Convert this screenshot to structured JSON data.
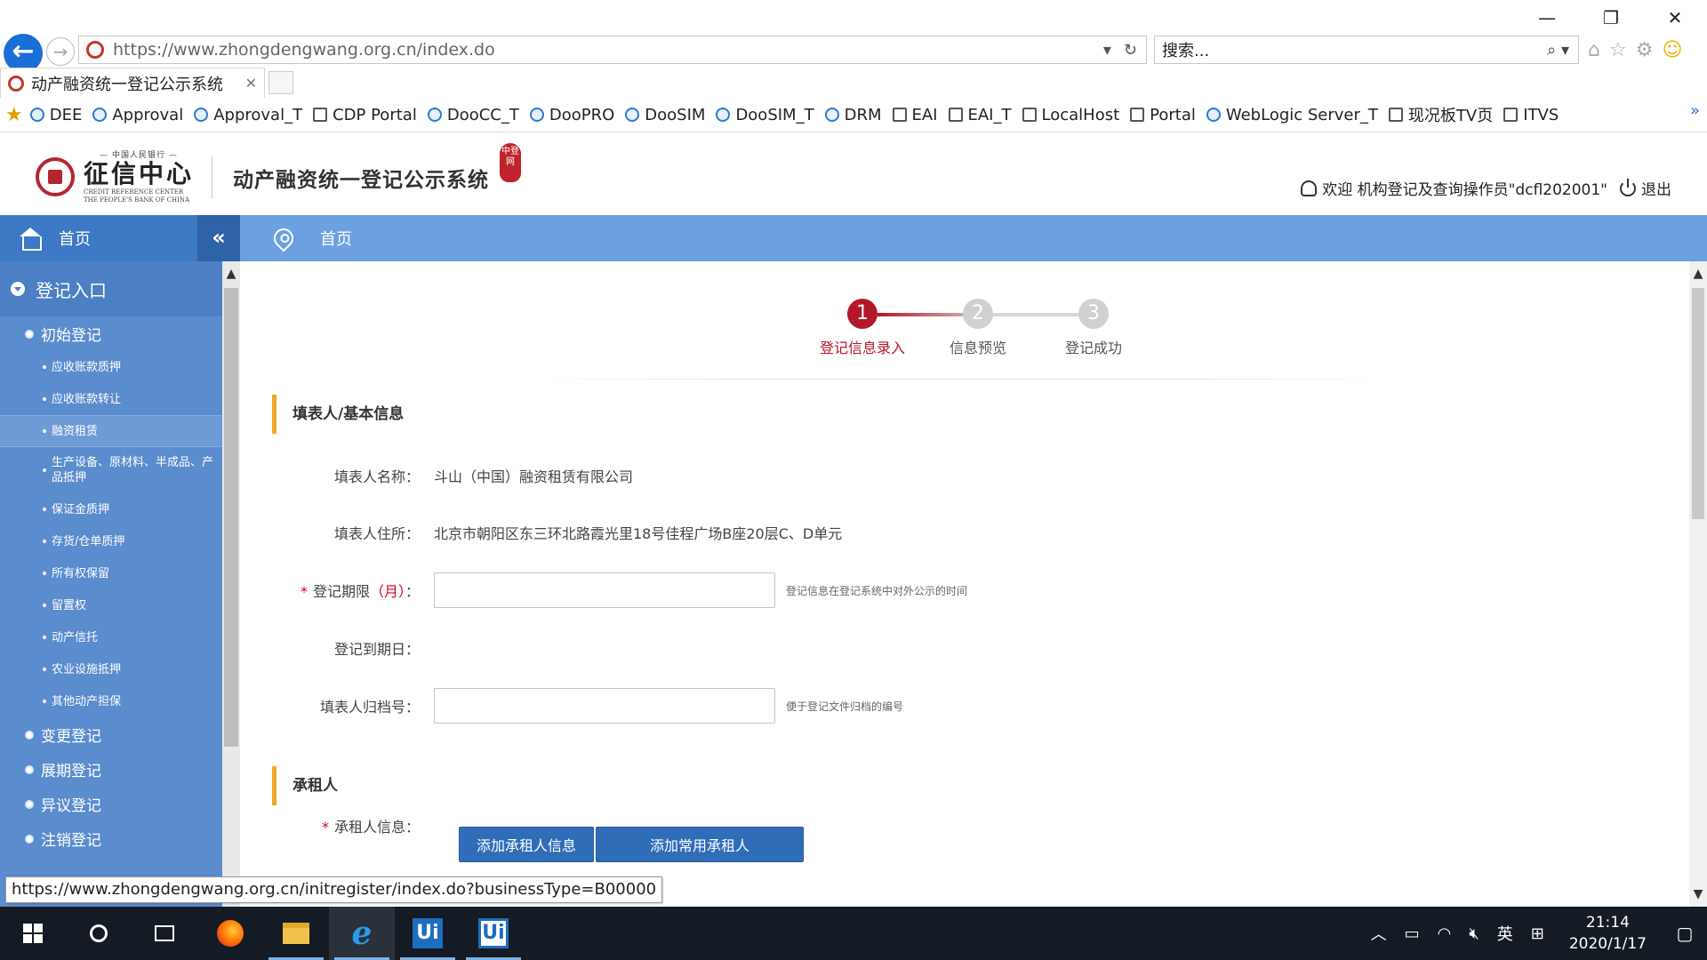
{
  "browser": {
    "address_url": "https://www.zhongdengwang.org.cn/index.do",
    "search_placeholder": "搜索...",
    "tab_title": "动产融资统一登记公示系统",
    "favorites": [
      "DEE",
      "Approval",
      "Approval_T",
      "CDP Portal",
      "DooCC_T",
      "DooPRO",
      "DooSIM",
      "DooSIM_T",
      "DRM",
      "EAI",
      "EAI_T",
      "LocalHost",
      "Portal",
      "WebLogic Server_T",
      "现况板TV页",
      "ITVS"
    ],
    "status_url": "https://www.zhongdengwang.org.cn/initregister/index.do?businessType=B00000"
  },
  "header": {
    "logo_top": "— 中国人民银行 —",
    "logo_main": "征信中心",
    "logo_en_1": "CREDIT REFERENCE CENTER",
    "logo_en_2": "THE PEOPLE'S BANK OF CHINA",
    "system_title": "动产融资统一登记公示系统",
    "stamp": "中登网",
    "welcome": "欢迎 机构登记及查询操作员\"dcfl202001\"",
    "logout": "退出"
  },
  "sidebar": {
    "home": "首页",
    "collapse_glyph": "«",
    "section": "登记入口",
    "groups": [
      {
        "label": "初始登记",
        "items": [
          "应收账款质押",
          "应收账款转让",
          "融资租赁",
          "生产设备、原材料、半成品、产品抵押",
          "保证金质押",
          "存货/仓单质押",
          "所有权保留",
          "留置权",
          "动产信托",
          "农业设施抵押",
          "其他动产担保"
        ]
      },
      {
        "label": "变更登记"
      },
      {
        "label": "展期登记"
      },
      {
        "label": "异议登记"
      },
      {
        "label": "注销登记"
      }
    ]
  },
  "breadcrumb": "首页",
  "steps": [
    {
      "num": "1",
      "label": "登记信息录入",
      "active": true
    },
    {
      "num": "2",
      "label": "信息预览",
      "active": false
    },
    {
      "num": "3",
      "label": "登记成功",
      "active": false
    }
  ],
  "form": {
    "section1": "填表人/基本信息",
    "filer_name_label": "填表人名称：",
    "filer_name": "斗山（中国）融资租赁有限公司",
    "filer_addr_label": "填表人住所：",
    "filer_addr": "北京市朝阳区东三环北路霞光里18号佳程广场B座20层C、D单元",
    "period_req": "*",
    "period_label": "登记期限",
    "period_unit": "（月）",
    "period_colon": "：",
    "period_value": "",
    "period_hint": "登记信息在登记系统中对外公示的时间",
    "expiry_label": "登记到期日：",
    "archive_label": "填表人归档号：",
    "archive_value": "",
    "archive_hint": "便于登记文件归档的编号",
    "section2": "承租人",
    "lessee_req": "*",
    "lessee_label": "承租人信息：",
    "add_lessee_btn": "添加承租人信息",
    "add_common_btn": "添加常用承租人"
  },
  "taskbar": {
    "ime": "英",
    "time": "21:14",
    "date": "2020/1/17"
  }
}
